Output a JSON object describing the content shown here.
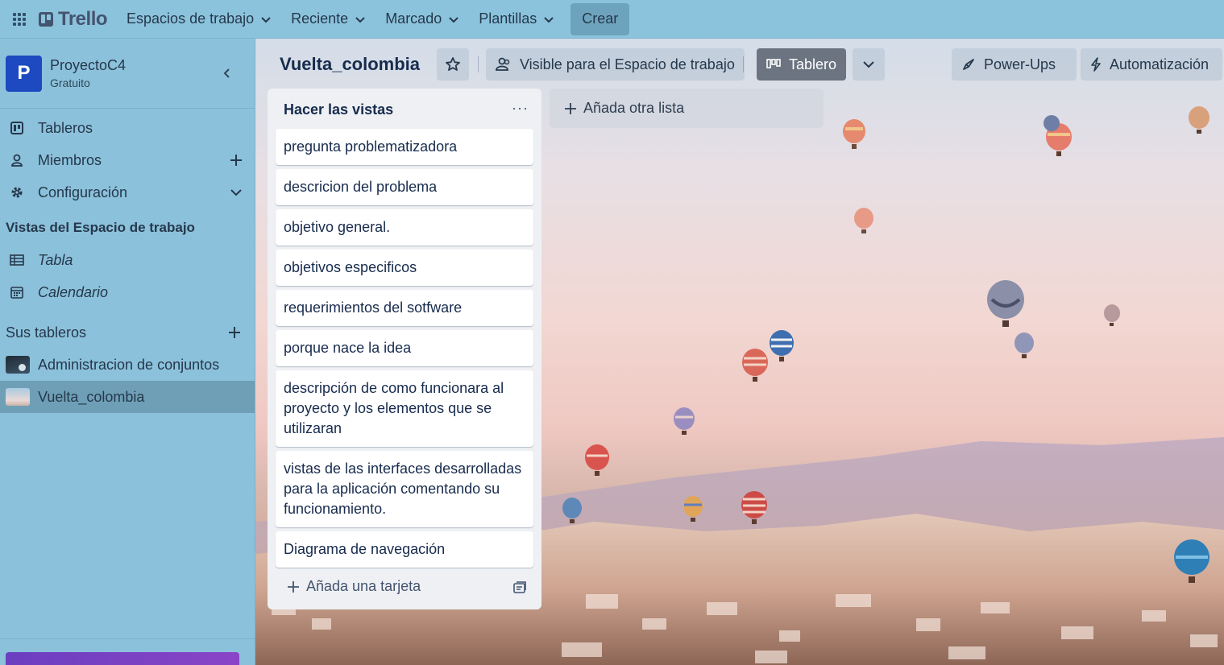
{
  "topbar": {
    "logo_text": "Trello",
    "nav": [
      {
        "label": "Espacios de trabajo"
      },
      {
        "label": "Reciente"
      },
      {
        "label": "Marcado"
      },
      {
        "label": "Plantillas"
      }
    ],
    "create_label": "Crear"
  },
  "sidebar": {
    "workspace": {
      "initial": "P",
      "name": "ProyectoC4",
      "plan": "Gratuito"
    },
    "items": [
      {
        "label": "Tableros",
        "icon": "board-icon"
      },
      {
        "label": "Miembros",
        "icon": "person-icon"
      },
      {
        "label": "Configuración",
        "icon": "gear-icon"
      }
    ],
    "views_title": "Vistas del Espacio de trabajo",
    "views": [
      {
        "label": "Tabla",
        "icon": "table-icon"
      },
      {
        "label": "Calendario",
        "icon": "calendar-icon"
      }
    ],
    "boards_title": "Sus tableros",
    "boards": [
      {
        "label": "Administracion de conjuntos"
      },
      {
        "label": "Vuelta_colombia",
        "active": true
      }
    ]
  },
  "board": {
    "title": "Vuelta_colombia",
    "visibility_label": "Visible para el Espacio de trabajo",
    "view_label": "Tablero",
    "powerups_label": "Power-Ups",
    "automation_label": "Automatización",
    "add_list_label": "Añada otra lista"
  },
  "list": {
    "title": "Hacer las vistas",
    "cards": [
      "pregunta problematizadora",
      "descricion del problema",
      "objetivo general.",
      "objetivos especificos",
      "requerimientos del sotfware",
      "porque nace la idea",
      "descripción de como funcionara al proyecto y los elementos que se utilizaran",
      "vistas de las interfaces desarrolladas para la aplicación comentando su funcionamiento.",
      "Diagrama de navegación"
    ],
    "add_card_label": "Añada una tarjeta"
  },
  "colors": {
    "topbar_bg": "#8cc3dc",
    "sidebar_bg": "#8cc1db",
    "workspace_avatar": "#1d4ac0",
    "list_bg": "#eef0f4"
  }
}
